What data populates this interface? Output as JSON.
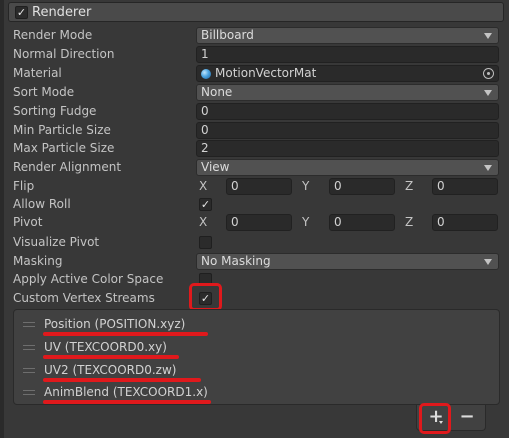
{
  "component": {
    "title": "Renderer",
    "enabled_check": "✓"
  },
  "properties": {
    "render_mode": {
      "label": "Render Mode",
      "value": "Billboard"
    },
    "normal_direction": {
      "label": "Normal Direction",
      "value": "1"
    },
    "material": {
      "label": "Material",
      "value": "MotionVectorMat"
    },
    "sort_mode": {
      "label": "Sort Mode",
      "value": "None"
    },
    "sorting_fudge": {
      "label": "Sorting Fudge",
      "value": "0"
    },
    "min_particle_size": {
      "label": "Min Particle Size",
      "value": "0"
    },
    "max_particle_size": {
      "label": "Max Particle Size",
      "value": "2"
    },
    "render_alignment": {
      "label": "Render Alignment",
      "value": "View"
    },
    "flip": {
      "label": "Flip",
      "x_label": "X",
      "x": "0",
      "y_label": "Y",
      "y": "0",
      "z_label": "Z",
      "z": "0"
    },
    "allow_roll": {
      "label": "Allow Roll",
      "check": "✓"
    },
    "pivot": {
      "label": "Pivot",
      "x_label": "X",
      "x": "0",
      "y_label": "Y",
      "y": "0",
      "z_label": "Z",
      "z": "0"
    },
    "visualize_pivot": {
      "label": "Visualize Pivot",
      "check": ""
    },
    "masking": {
      "label": "Masking",
      "value": "No Masking"
    },
    "apply_active_color_space": {
      "label": "Apply Active Color Space",
      "check": ""
    },
    "custom_vertex_streams": {
      "label": "Custom Vertex Streams",
      "check": "✓"
    }
  },
  "vertex_streams": [
    {
      "label": "Position (POSITION.xyz)"
    },
    {
      "label": "UV (TEXCOORD0.xy)"
    },
    {
      "label": "UV2 (TEXCOORD0.zw)"
    },
    {
      "label": "AnimBlend (TEXCOORD1.x)"
    }
  ],
  "footer": {
    "add_label": "+",
    "remove_label": "−"
  },
  "colors": {
    "highlight": "#e0191c",
    "panel_bg": "#383838",
    "field_bg": "#2a2a2a"
  }
}
